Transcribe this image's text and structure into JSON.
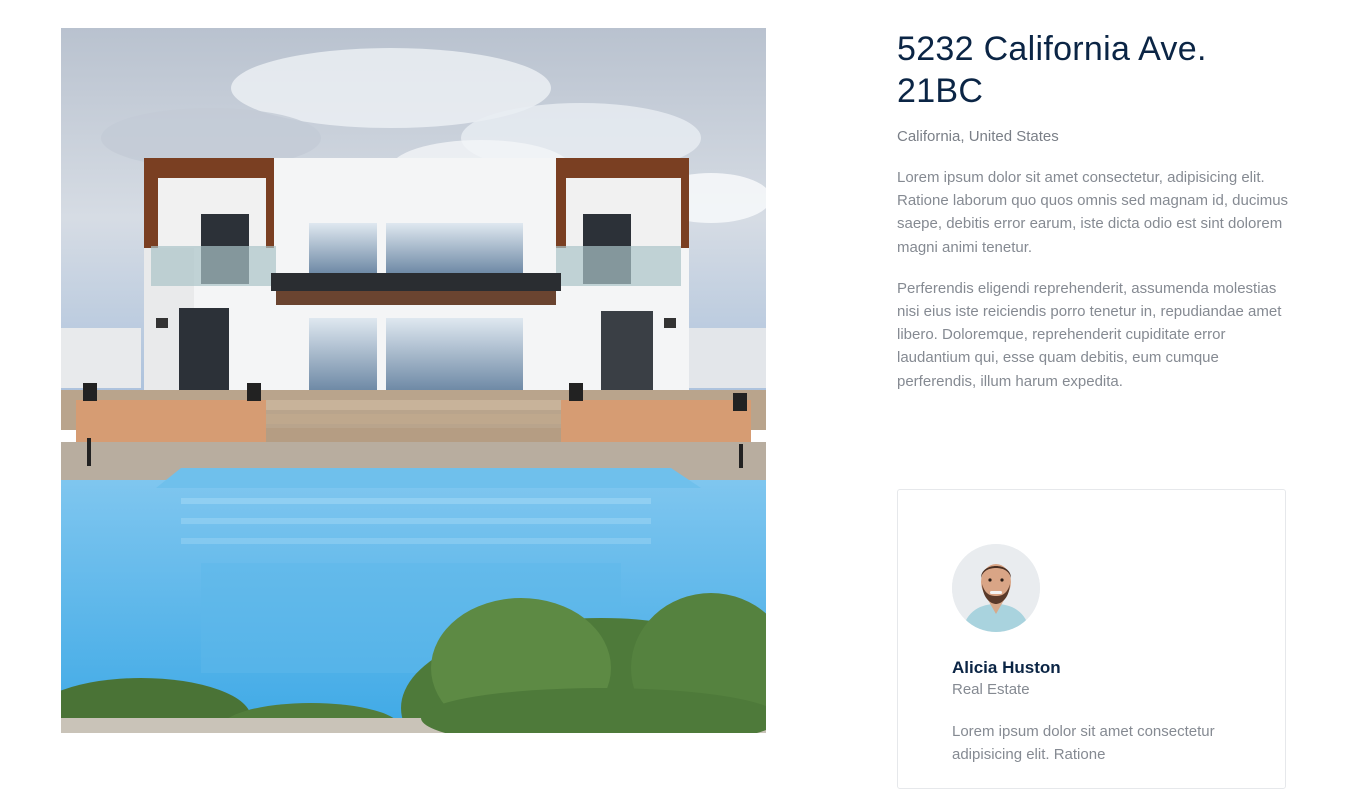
{
  "listing": {
    "title": "5232 California Ave. 21BC",
    "location": "California, United States",
    "paragraphs": [
      "Lorem ipsum dolor sit amet consectetur, adipisicing elit. Ratione laborum quo quos omnis sed magnam id, ducimus saepe, debitis error earum, iste dicta odio est sint dolorem magni animi tenetur.",
      "Perferendis eligendi reprehenderit, assumenda molestias nisi eius iste reiciendis porro tenetur in, repudiandae amet libero. Doloremque, reprehenderit cupiditate error laudantium qui, esse quam debitis, eum cumque perferendis, illum harum expedita."
    ]
  },
  "agent": {
    "name": "Alicia Huston",
    "role": "Real Estate",
    "bio": "Lorem ipsum dolor sit amet consectetur adipisicing elit. Ratione"
  },
  "colors": {
    "heading": "#0b2545",
    "body_text": "#858a92",
    "pool": "#4fb3ea",
    "sky": "#c9d3e0"
  },
  "icons": {
    "property_photo": "modern-villa-with-pool-image",
    "agent_avatar": "man-portrait-avatar"
  }
}
